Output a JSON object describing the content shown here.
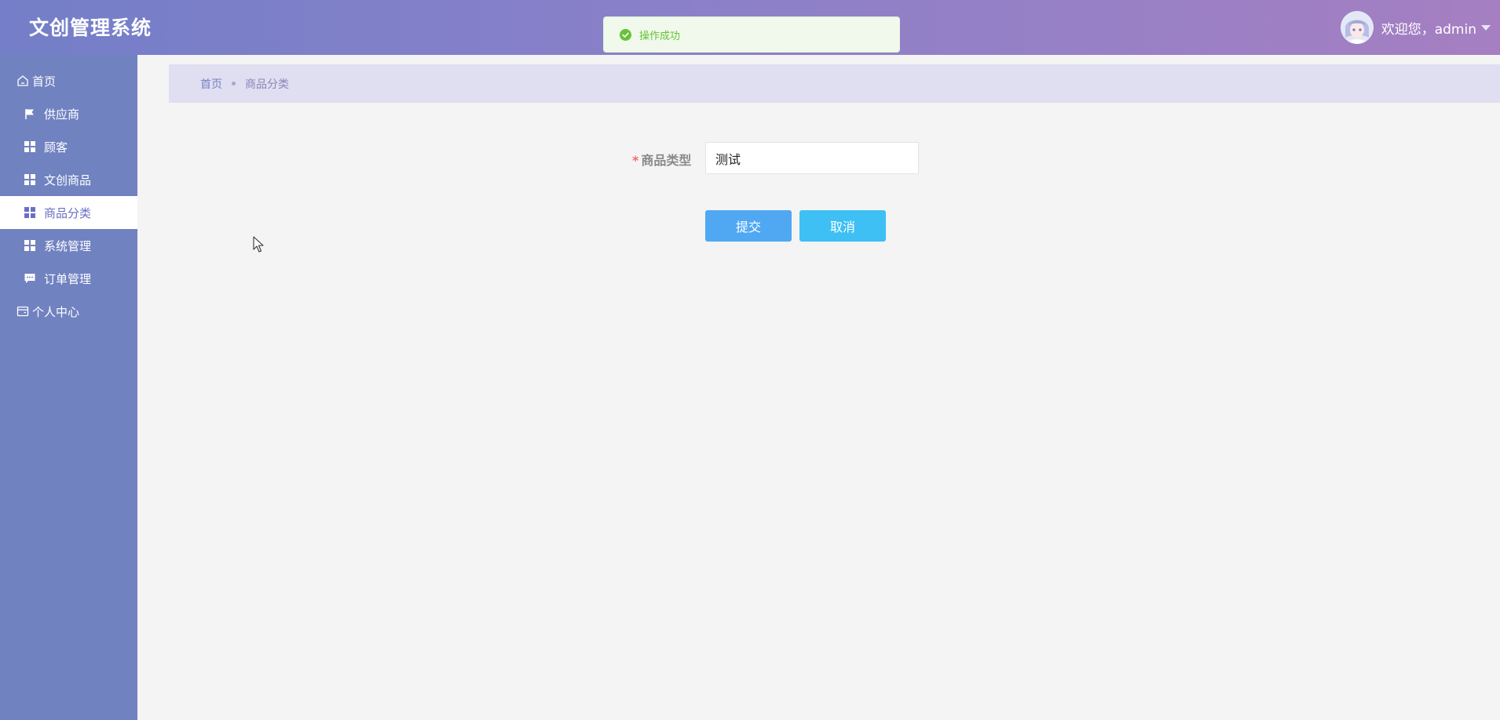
{
  "header": {
    "app_title": "文创管理系统",
    "welcome_text": "欢迎您，admin"
  },
  "toast": {
    "message": "操作成功",
    "type": "success"
  },
  "sidebar": {
    "items": [
      {
        "label": "首页",
        "icon": "home-icon",
        "level": "top"
      },
      {
        "label": "供应商",
        "icon": "flag-icon",
        "level": "sub"
      },
      {
        "label": "顾客",
        "icon": "grid-icon",
        "level": "sub"
      },
      {
        "label": "文创商品",
        "icon": "grid-icon",
        "level": "sub"
      },
      {
        "label": "商品分类",
        "icon": "grid-icon",
        "level": "sub",
        "active": true
      },
      {
        "label": "系统管理",
        "icon": "grid-icon",
        "level": "sub"
      },
      {
        "label": "订单管理",
        "icon": "chat-icon",
        "level": "sub"
      },
      {
        "label": "个人中心",
        "icon": "wallet-icon",
        "level": "top"
      }
    ]
  },
  "breadcrumb": {
    "home": "首页",
    "current": "商品分类"
  },
  "form": {
    "required_mark": "*",
    "field_label": "商品类型",
    "field_value": "测试",
    "submit_label": "提交",
    "cancel_label": "取消"
  },
  "colors": {
    "header_gradient_start": "#737fc8",
    "header_gradient_end": "#a57fc2",
    "sidebar_bg": "#7182c1",
    "active_text": "#6a6fc4",
    "success_green": "#67c23a",
    "submit_button": "#50a8f3",
    "cancel_button": "#3ec0f4",
    "required_red": "#f56c6c"
  }
}
